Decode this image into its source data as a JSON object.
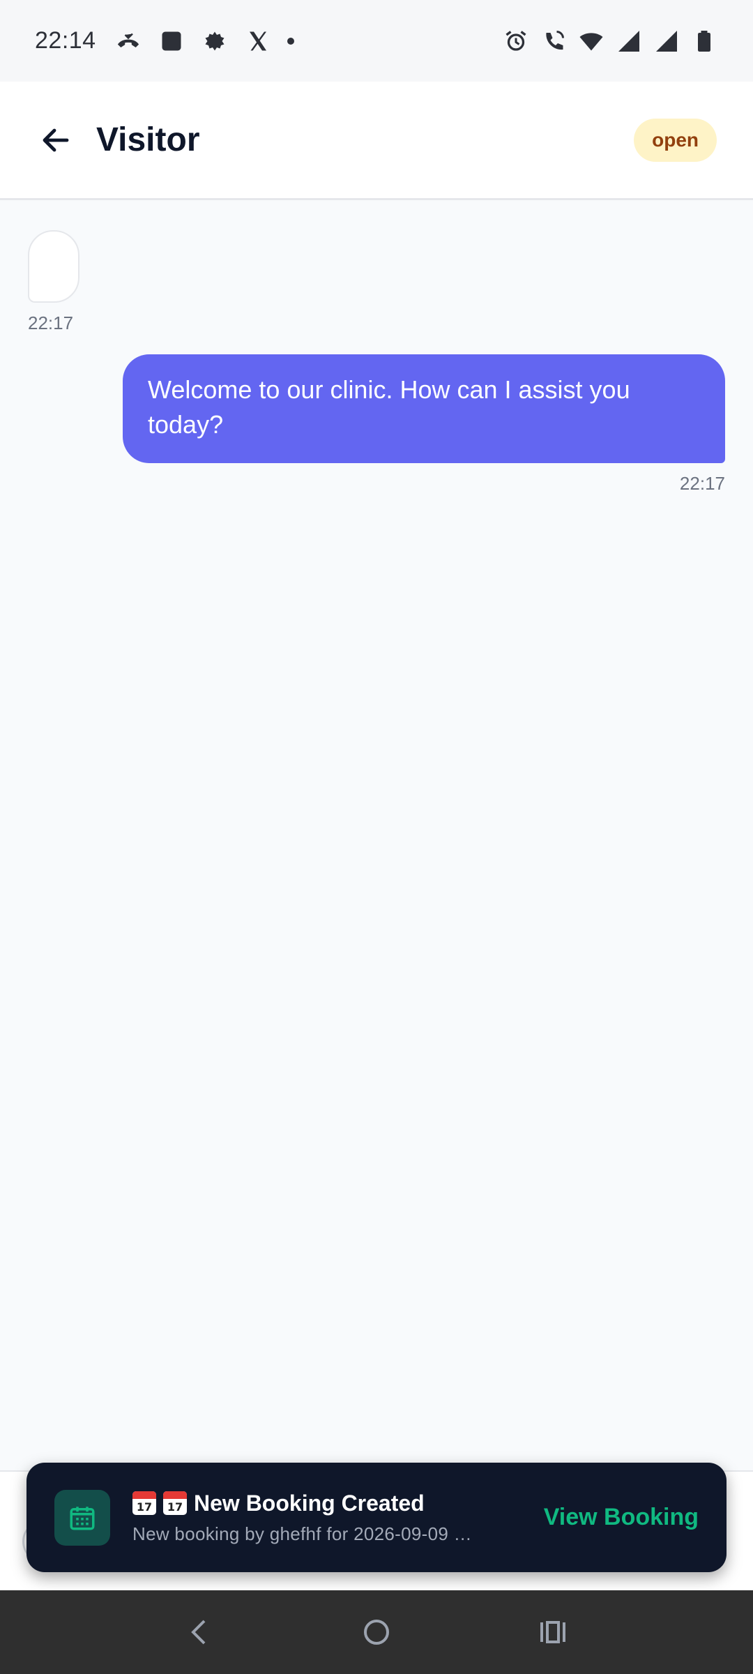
{
  "status_bar": {
    "time": "22:14",
    "left_icons": [
      "missed-call-icon",
      "app-square-icon",
      "leaf-app-icon",
      "x-logo-icon",
      "notification-dot-icon"
    ],
    "right_icons": [
      "alarm-icon",
      "wifi-calling-icon",
      "wifi-icon",
      "signal-icon",
      "signal-icon",
      "battery-icon"
    ]
  },
  "header": {
    "title": "Visitor",
    "status_badge": "open",
    "back_icon": "arrow-back-icon"
  },
  "messages": [
    {
      "direction": "incoming",
      "text": "",
      "time": "22:17"
    },
    {
      "direction": "outgoing",
      "text": "Welcome to our clinic. How can I assist you today?",
      "time": "22:17"
    }
  ],
  "snackbar": {
    "icon": "calendar-icon",
    "title": "New Booking Created",
    "title_emoji_day": "17",
    "subtitle": "New booking by ghefhf for 2026-09-09 …",
    "action_label": "View Booking"
  },
  "nav_bar": {
    "back": "nav-back-icon",
    "home": "nav-home-icon",
    "recents": "nav-recents-icon"
  },
  "colors": {
    "accent": "#6366f1",
    "badge_bg": "#fef3c7",
    "badge_text": "#92400e",
    "snackbar_bg": "#0f172a",
    "snackbar_action": "#10b981"
  }
}
